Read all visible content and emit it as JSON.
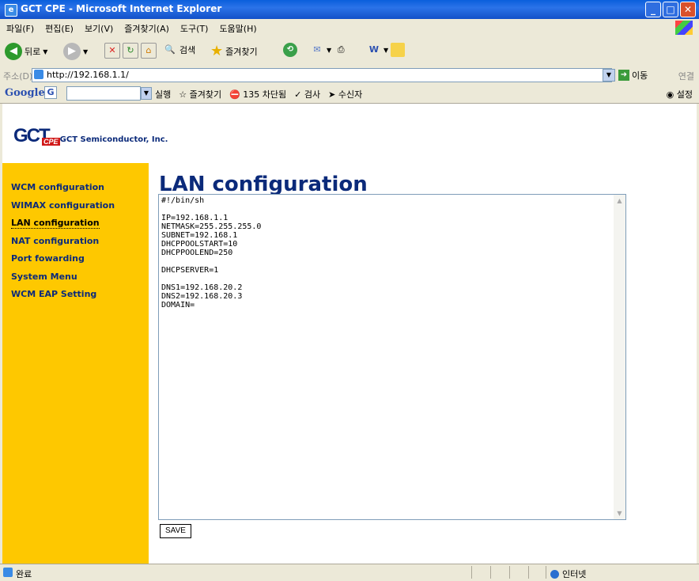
{
  "window": {
    "title": "GCT CPE - Microsoft Internet Explorer"
  },
  "menu": [
    "파일(F)",
    "편집(E)",
    "보기(V)",
    "즐겨찾기(A)",
    "도구(T)",
    "도움말(H)"
  ],
  "toolbar": {
    "back": "뒤로",
    "search": "검색",
    "favorites": "즐겨찾기"
  },
  "address": {
    "label": "주소(D)",
    "url": "http://192.168.1.1/",
    "go": "이동",
    "links": "연결"
  },
  "googlebar": {
    "logo": "Google",
    "search_btn": "실행",
    "favorites": "즐겨찾기",
    "blocked": "135 차단됨",
    "check": "검사",
    "autofill": "수신자",
    "settings": "설정"
  },
  "header": {
    "company": "GCT Semiconductor, Inc."
  },
  "sidebar": {
    "items": [
      {
        "label": "WCM configuration"
      },
      {
        "label": "WIMAX configuration"
      },
      {
        "label": "LAN configuration"
      },
      {
        "label": "NAT configuration"
      },
      {
        "label": "Port fowarding"
      },
      {
        "label": "System Menu"
      },
      {
        "label": "WCM EAP Setting"
      }
    ]
  },
  "main": {
    "title": "LAN configuration",
    "config": "#!/bin/sh\n\nIP=192.168.1.1\nNETMASK=255.255.255.0\nSUBNET=192.168.1\nDHCPPOOLSTART=10\nDHCPPOOLEND=250\n\nDHCPSERVER=1\n\nDNS1=192.168.20.2\nDNS2=192.168.20.3\nDOMAIN=",
    "save_label": "SAVE"
  },
  "status": {
    "text": "완료",
    "zone": "인터넷"
  }
}
